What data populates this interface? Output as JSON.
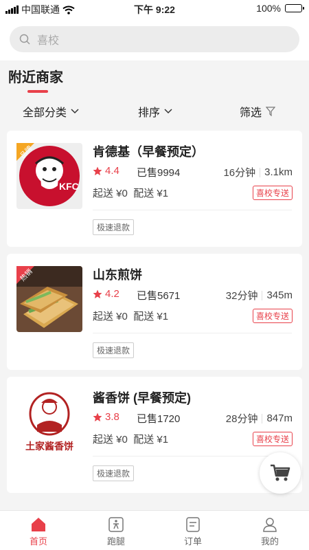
{
  "status_bar": {
    "carrier": "中国联通",
    "time": "下午 9:22",
    "battery": "100%",
    "battery_level": 1.0
  },
  "search": {
    "placeholder": "喜校"
  },
  "section": {
    "title": "附近商家"
  },
  "filters": {
    "category": "全部分类",
    "sort": "排序",
    "filter": "筛选"
  },
  "stores": [
    {
      "name": "肯德基（早餐预定）",
      "rating": "4.4",
      "sold": "已售9994",
      "time": "16分钟",
      "distance": "3.1km",
      "min_order": "起送 ¥0",
      "delivery_fee": "配送 ¥1",
      "delivery_tag": "喜校专送",
      "refund_tag": "极速退款",
      "badge": "品牌",
      "badge_color": "#f5a623",
      "logo_text": "KFC",
      "logo_color": "#c8102e"
    },
    {
      "name": "山东煎饼",
      "rating": "4.2",
      "sold": "已售5671",
      "time": "32分钟",
      "distance": "345m",
      "min_order": "起送 ¥0",
      "delivery_fee": "配送 ¥1",
      "delivery_tag": "喜校专送",
      "refund_tag": "极速退款",
      "badge": "热销",
      "badge_color": "#e8404a"
    },
    {
      "name": "酱香饼 (早餐预定)",
      "rating": "3.8",
      "sold": "已售1720",
      "time": "28分钟",
      "distance": "847m",
      "min_order": "起送 ¥0",
      "delivery_fee": "配送 ¥1",
      "delivery_tag": "喜校专送",
      "refund_tag": "极速退款",
      "logo_text": "土家酱香饼",
      "logo_color": "#b22222"
    }
  ],
  "tabs": [
    {
      "label": "首页",
      "icon": "home-icon",
      "active": true
    },
    {
      "label": "跑腿",
      "icon": "errand-icon",
      "active": false
    },
    {
      "label": "订单",
      "icon": "order-icon",
      "active": false
    },
    {
      "label": "我的",
      "icon": "profile-icon",
      "active": false
    }
  ],
  "colors": {
    "accent": "#e8404a"
  }
}
